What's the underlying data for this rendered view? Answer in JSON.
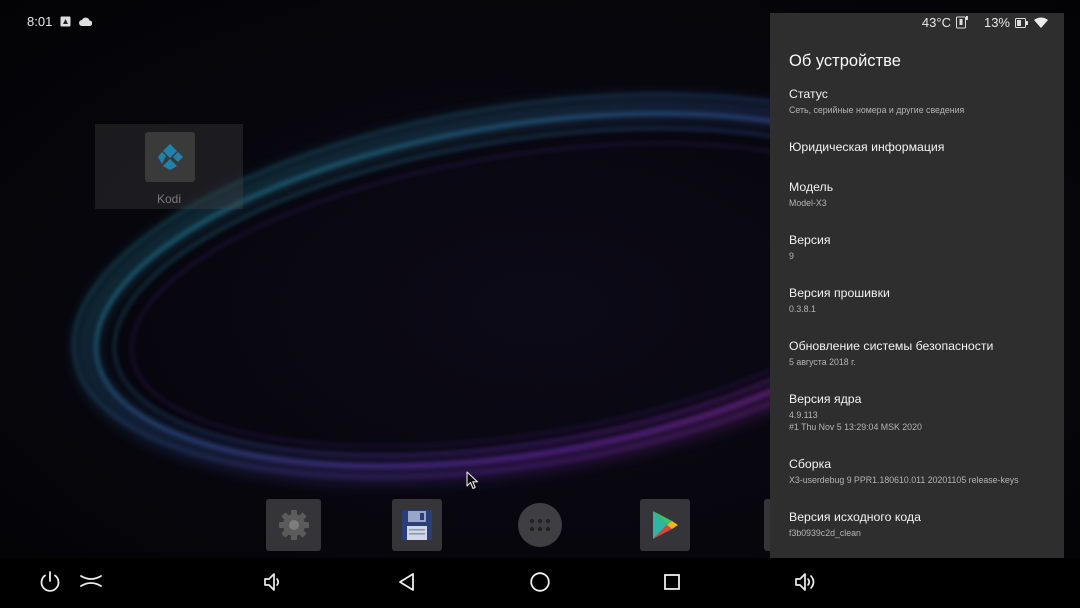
{
  "status_bar": {
    "time": "8:01",
    "temperature": "43°C",
    "battery": "13%",
    "icons": [
      "android-notification-icon",
      "cloud-icon",
      "thermometer-icon",
      "battery-icon",
      "wifi-icon"
    ]
  },
  "desktop": {
    "shortcut": {
      "label": "Kodi",
      "icon": "kodi-icon"
    },
    "dock": [
      {
        "icon": "settings-gear-icon"
      },
      {
        "icon": "floppy-save-icon"
      },
      {
        "icon": "all-apps-icon"
      },
      {
        "icon": "play-store-icon"
      }
    ]
  },
  "about_panel": {
    "title": "Об устройстве",
    "items": [
      {
        "title": "Статус",
        "subtitle": "Сеть, серийные номера и другие сведения"
      },
      {
        "title": "Юридическая информация",
        "subtitle": ""
      },
      {
        "title": "Модель",
        "subtitle": "Model-X3"
      },
      {
        "title": "Версия",
        "subtitle": "9"
      },
      {
        "title": "Версия прошивки",
        "subtitle": "0.3.8.1"
      },
      {
        "title": "Обновление системы безопасности",
        "subtitle": "5 августа 2018 г."
      },
      {
        "title": "Версия ядра",
        "subtitle": "4.9.113",
        "subtitle2": "#1 Thu Nov 5 13:29:04 MSK 2020"
      },
      {
        "title": "Сборка",
        "subtitle": "X3-userdebug 9 PPR1.180610.011 20201105 release-keys"
      },
      {
        "title": "Версия исходного кода",
        "subtitle": "f3b0939c2d_clean"
      }
    ]
  },
  "nav_bar": {
    "buttons": [
      "power-icon",
      "collapse-icon",
      "volume-down-icon",
      "back-icon",
      "home-icon",
      "recents-icon",
      "volume-up-icon"
    ]
  },
  "colors": {
    "panel_bg": "#2e2e2e",
    "ring_cyan": "#2bc7c0",
    "ring_purple": "#8a3ad0",
    "ring_magenta": "#b0308a"
  }
}
